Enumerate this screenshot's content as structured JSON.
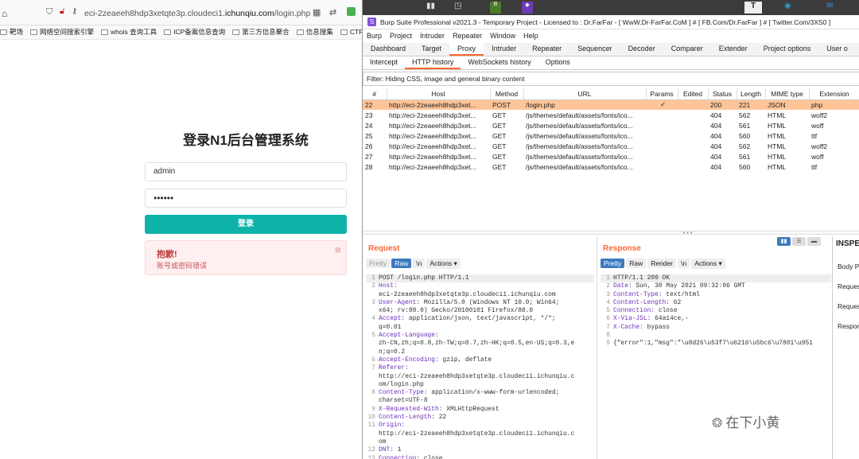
{
  "browser": {
    "url_gray": "eci-2zeaeeh8hdp3xetqte3p.cloudeci1.",
    "url_dark": "ichunqiu.com",
    "url_tail": "/login.php",
    "bookmarks": [
      "靶场",
      "网络空间搜索引擎",
      "whois 查询工具",
      "ICP备案信息查询",
      "第三方信息聚合",
      "信息搜集",
      "CTF"
    ]
  },
  "login": {
    "title": "登录N1后台管理系统",
    "username": "admin",
    "password": "••••••",
    "button": "登录",
    "error_title": "抱歉!",
    "error_msg": "账号或密码错误"
  },
  "burp": {
    "title": "Burp Suite Professional v2021.3 - Temporary Project - Licensed to : Dr.FarFar - [ WwW.Dr-FarFar.CoM ] # [ FB.Com/Dr.FarFar ] # [ Twitter.Com/3XS0 ]",
    "menu": [
      "Burp",
      "Project",
      "Intruder",
      "Repeater",
      "Window",
      "Help"
    ],
    "tabs": [
      "Dashboard",
      "Target",
      "Proxy",
      "Intruder",
      "Repeater",
      "Sequencer",
      "Decoder",
      "Comparer",
      "Extender",
      "Project options",
      "User o"
    ],
    "active_tab": "Proxy",
    "subtabs": [
      "Intercept",
      "HTTP history",
      "WebSockets history",
      "Options"
    ],
    "active_subtab": "HTTP history",
    "filter": "Filter: Hiding CSS, image and general binary content",
    "columns": [
      "#",
      "Host",
      "Method",
      "URL",
      "Params",
      "Edited",
      "Status",
      "Length",
      "MIME type",
      "Extension"
    ],
    "rows": [
      [
        "22",
        "http://eci-2zeaeeh8hdp3xet...",
        "POST",
        "/login.php",
        "✓",
        "",
        "200",
        "221",
        "JSON",
        "php"
      ],
      [
        "23",
        "http://eci-2zeaeeh8hdp3xet...",
        "GET",
        "/js/themes/default/assets/fonts/ico...",
        "",
        "",
        "404",
        "562",
        "HTML",
        "woff2"
      ],
      [
        "24",
        "http://eci-2zeaeeh8hdp3xet...",
        "GET",
        "/js/themes/default/assets/fonts/ico...",
        "",
        "",
        "404",
        "561",
        "HTML",
        "woff"
      ],
      [
        "25",
        "http://eci-2zeaeeh8hdp3xet...",
        "GET",
        "/js/themes/default/assets/fonts/ico...",
        "",
        "",
        "404",
        "560",
        "HTML",
        "ttf"
      ],
      [
        "26",
        "http://eci-2zeaeeh8hdp3xet...",
        "GET",
        "/js/themes/default/assets/fonts/ico...",
        "",
        "",
        "404",
        "562",
        "HTML",
        "woff2"
      ],
      [
        "27",
        "http://eci-2zeaeeh8hdp3xet...",
        "GET",
        "/js/themes/default/assets/fonts/ico...",
        "",
        "",
        "404",
        "561",
        "HTML",
        "woff"
      ],
      [
        "28",
        "http://eci-2zeaeeh8hdp3xet...",
        "GET",
        "/js/themes/default/assets/fonts/ico...",
        "",
        "",
        "404",
        "560",
        "HTML",
        "ttf"
      ]
    ],
    "request": {
      "title": "Request",
      "buttons": [
        "Pretty",
        "Raw",
        "\\n",
        "Actions ▾"
      ],
      "active": "Raw",
      "lines": [
        [
          "1",
          "",
          "POST /login.php HTTP/1.1"
        ],
        [
          "2",
          "Host:",
          ""
        ],
        [
          "",
          "",
          "eci-2zeaeeh8hdp3xetqte3p.cloudeci1.ichunqiu.com"
        ],
        [
          "3",
          "User-Agent:",
          " Mozilla/5.0 (Windows NT 10.0; Win64;"
        ],
        [
          "",
          "",
          "x64; rv:88.0) Gecko/20100101 Firefox/88.0"
        ],
        [
          "4",
          "Accept:",
          " application/json, text/javascript, */*;"
        ],
        [
          "",
          "",
          "q=0.01"
        ],
        [
          "5",
          "Accept-Language:",
          ""
        ],
        [
          "",
          "",
          "zh-CN,zh;q=0.8,zh-TW;q=0.7,zh-HK;q=0.5,en-US;q=0.3,e"
        ],
        [
          "",
          "",
          "n;q=0.2"
        ],
        [
          "6",
          "Accept-Encoding:",
          " gzip, deflate"
        ],
        [
          "7",
          "Referer:",
          ""
        ],
        [
          "",
          "",
          "http://eci-2zeaeeh8hdp3xetqte3p.cloudeci1.ichunqiu.c"
        ],
        [
          "",
          "",
          "om/login.php"
        ],
        [
          "8",
          "Content-Type:",
          " application/x-www-form-urlencoded;"
        ],
        [
          "",
          "",
          "charset=UTF-8"
        ],
        [
          "9",
          "X-Requested-With:",
          " XMLHttpRequest"
        ],
        [
          "10",
          "Content-Length:",
          " 22"
        ],
        [
          "11",
          "Origin:",
          ""
        ],
        [
          "",
          "",
          "http://eci-2zeaeeh8hdp3xetqte3p.cloudeci1.ichunqiu.c"
        ],
        [
          "",
          "",
          "om"
        ],
        [
          "12",
          "DNT:",
          " 1"
        ],
        [
          "13",
          "Connection:",
          " close"
        ]
      ]
    },
    "response": {
      "title": "Response",
      "buttons": [
        "Pretty",
        "Raw",
        "Render",
        "\\n",
        "Actions ▾"
      ],
      "active": "Pretty",
      "lines": [
        [
          "1",
          "",
          "HTTP/1.1 200 OK"
        ],
        [
          "2",
          "Date:",
          " Sun, 30 May 2021 09:32:06 GMT"
        ],
        [
          "3",
          "Content-Type:",
          " text/html"
        ],
        [
          "4",
          "Content-Length:",
          " 62"
        ],
        [
          "5",
          "Connection:",
          " close"
        ],
        [
          "6",
          "X-Via-JSL:",
          " 64a14ce,-"
        ],
        [
          "7",
          "X-Cache:",
          " bypass"
        ],
        [
          "8",
          "",
          ""
        ],
        [
          "9",
          "",
          "{\"error\":1,\"msg\":\"\\u8d26\\u53f7\\u6216\\u5bc6\\u7801\\u951"
        ]
      ]
    },
    "inspector": {
      "title": "INSPEC",
      "rows": [
        "Body P",
        "Reques",
        "Reques",
        "Respon"
      ]
    }
  },
  "watermark": "在下小黄"
}
